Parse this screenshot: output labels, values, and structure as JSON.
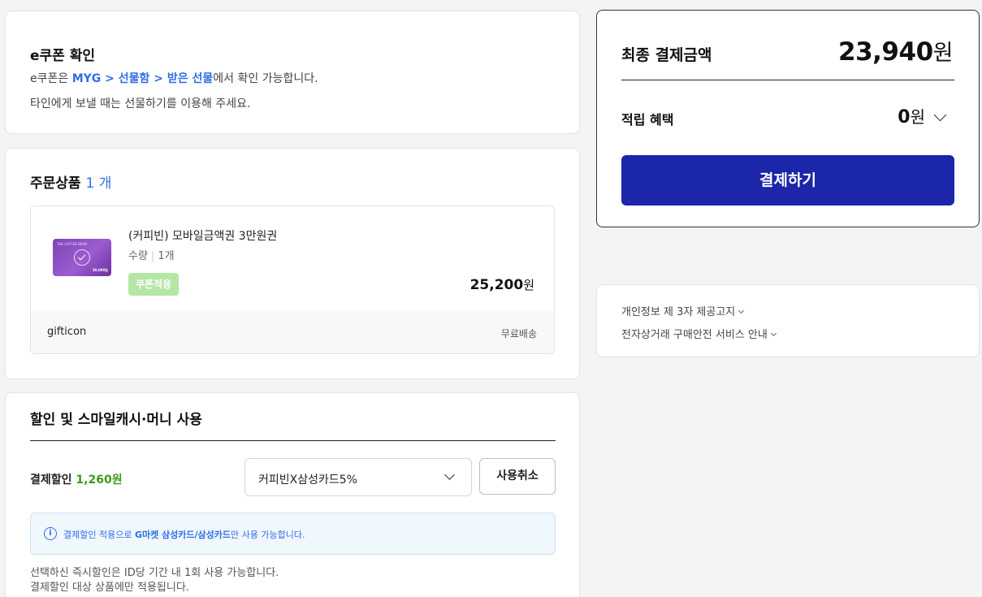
{
  "ecoupon": {
    "title": "e쿠폰 확인",
    "line1_prefix": "e쿠폰은 ",
    "line1_highlight": "MYG > 선물함 > 받은 선물",
    "line1_suffix": "에서 확인 가능합니다.",
    "line2": "타인에게 보낼 때는 선물하기를 이용해 주세요."
  },
  "order": {
    "title": "주문상품",
    "count": "1 개",
    "product": {
      "name": "(커피빈) 모바일금액권 3만원권",
      "qty_label": "수량",
      "qty_value": "1개",
      "badge": "쿠폰적용",
      "price": "25,200",
      "price_unit": "원",
      "thumb_brand": "THE COFFEE BEAN",
      "thumb_amount": "30,000원"
    },
    "seller": "gifticon",
    "shipping": "무료배송"
  },
  "discount": {
    "title": "할인 및 스마일캐시·머니 사용",
    "label": "결제할인",
    "amount": "1,260원",
    "selected_option": "커피빈X삼성카드5%",
    "cancel_label": "사용취소",
    "info_icon": "i",
    "info_prefix": "결제할인 적용으로 ",
    "info_bold": "G마켓 삼성카드/삼성카드",
    "info_suffix": "만 사용 가능합니다.",
    "note1": "선택하신 즉시할인은 ID당 기간 내 1회 사용 가능합니다.",
    "note2": "결제할인 대상 상품에만 적용됩니다."
  },
  "summary": {
    "final_label": "최종 결제금액",
    "final_amount": "23,940",
    "final_unit": "원",
    "reward_label": "적립 혜택",
    "reward_amount": "0",
    "reward_unit": "원",
    "pay_label": "결제하기"
  },
  "notices": {
    "privacy": "개인정보 제 3자 제공고지",
    "safety": "전자상거래 구매안전 서비스 안내"
  },
  "colors": {
    "accent_blue": "#2e6ee6",
    "pay_button": "#1b26a8",
    "discount_green": "#3c9a1e",
    "badge_green": "#b5e6a6"
  }
}
